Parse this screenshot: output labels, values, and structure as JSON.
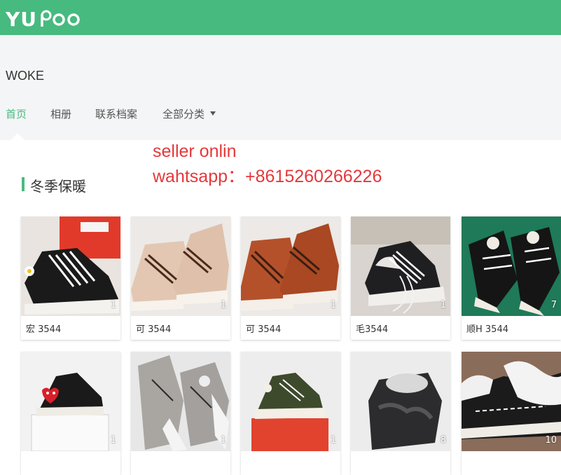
{
  "brand": {
    "logo_text": "YUPOO"
  },
  "shop": {
    "name": "WOKE"
  },
  "nav": {
    "home": "首页",
    "albums": "相册",
    "contact": "联系档案",
    "categories": "全部分类"
  },
  "overlay": {
    "line1": "seller onlin",
    "line2": "wahtsapp：+8615260266226"
  },
  "section": {
    "title": "冬季保暖"
  },
  "albums": [
    {
      "caption": "宏 3544",
      "count": "1"
    },
    {
      "caption": "可 3544",
      "count": "1"
    },
    {
      "caption": "可 3544",
      "count": "1"
    },
    {
      "caption": "毛3544",
      "count": "1"
    },
    {
      "caption": "顺H 3544",
      "count": "7"
    },
    {
      "caption": "",
      "count": "1"
    },
    {
      "caption": "",
      "count": "1"
    },
    {
      "caption": "",
      "count": "1"
    },
    {
      "caption": "",
      "count": "8"
    },
    {
      "caption": "",
      "count": "10"
    }
  ],
  "colors": {
    "accent": "#47ba7f",
    "overlay_text": "#e5383b"
  }
}
